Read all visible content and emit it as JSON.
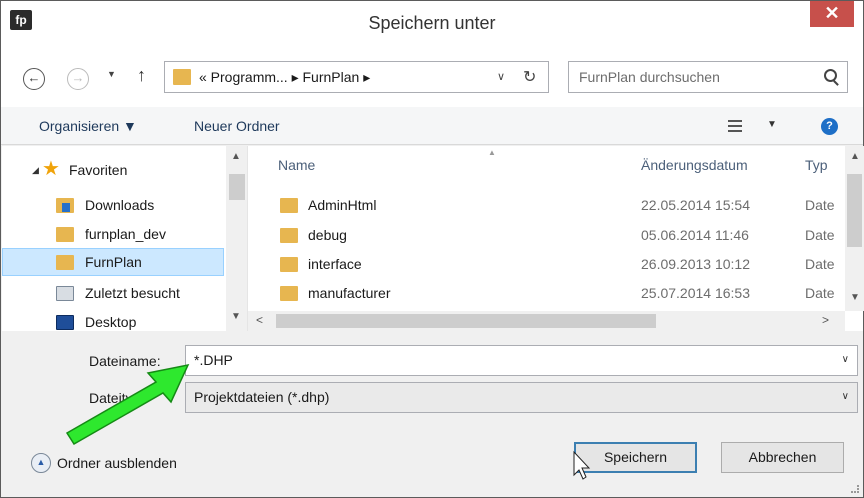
{
  "window": {
    "title": "Speichern unter",
    "app_icon_text": "fp",
    "close_glyph": "✕"
  },
  "address": {
    "breadcrumbs": "« Programm... ▸ FurnPlan ▸",
    "search_placeholder": "FurnPlan durchsuchen"
  },
  "toolbar": {
    "organize_label": "Organisieren ▼",
    "new_folder_label": "Neuer Ordner",
    "help_glyph": "?"
  },
  "navigation": {
    "items": [
      {
        "label": "Favoriten",
        "icon": "star-icon"
      },
      {
        "label": "Downloads",
        "icon": "downloads-folder-icon"
      },
      {
        "label": "furnplan_dev",
        "icon": "folder-icon"
      },
      {
        "label": "FurnPlan",
        "icon": "folder-icon",
        "selected": true
      },
      {
        "label": "Zuletzt besucht",
        "icon": "recent-places-icon"
      },
      {
        "label": "Desktop",
        "icon": "desktop-icon"
      }
    ]
  },
  "file_list": {
    "columns": {
      "name": "Name",
      "date": "Änderungsdatum",
      "type": "Typ"
    },
    "rows": [
      {
        "name": "AdminHtml",
        "date": "22.05.2014 15:54",
        "type": "Date"
      },
      {
        "name": "debug",
        "date": "05.06.2014 11:46",
        "type": "Date"
      },
      {
        "name": "interface",
        "date": "26.09.2013 10:12",
        "type": "Date"
      },
      {
        "name": "manufacturer",
        "date": "25.07.2014 16:53",
        "type": "Date"
      }
    ]
  },
  "form": {
    "filename_label": "Dateiname:",
    "filename_value": "*.DHP",
    "filetype_label": "Dateityp:",
    "filetype_value": "Projektdateien (*.dhp)"
  },
  "footer": {
    "hide_folders_label": "Ordner ausblenden",
    "save_label": "Speichern",
    "cancel_label": "Abbrechen"
  },
  "colors": {
    "selection": "#cce8ff",
    "folder": "#e7b650",
    "close_button": "#c7504b",
    "annotation_arrow": "#2ee82e"
  }
}
